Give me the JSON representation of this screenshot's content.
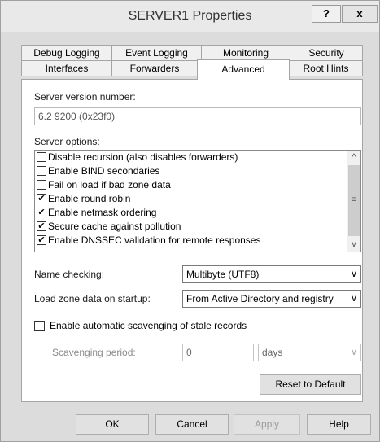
{
  "window": {
    "title": "SERVER1 Properties",
    "help_label": "?",
    "close_label": "x"
  },
  "tabs": {
    "row_top": [
      "Debug Logging",
      "Event Logging",
      "Monitoring",
      "Security"
    ],
    "row_bottom": [
      "Interfaces",
      "Forwarders",
      "Advanced",
      "Root Hints"
    ],
    "active": "Advanced"
  },
  "advanced": {
    "version_label": "Server version number:",
    "version_value": "6.2 9200 (0x23f0)",
    "options_label": "Server options:",
    "options": [
      {
        "label": "Disable recursion (also disables forwarders)",
        "checked": false,
        "mark": ""
      },
      {
        "label": "Enable BIND secondaries",
        "checked": false,
        "mark": ""
      },
      {
        "label": "Fail on load if bad zone data",
        "checked": false,
        "mark": ""
      },
      {
        "label": "Enable round robin",
        "checked": true,
        "mark": "✔"
      },
      {
        "label": "Enable netmask ordering",
        "checked": true,
        "mark": "✔"
      },
      {
        "label": "Secure cache against pollution",
        "checked": true,
        "mark": "✔"
      },
      {
        "label": "Enable DNSSEC validation for remote responses",
        "checked": true,
        "mark": "✔"
      }
    ],
    "name_checking_label": "Name checking:",
    "name_checking_value": "Multibyte (UTF8)",
    "load_zone_label": "Load zone data on startup:",
    "load_zone_value": "From Active Directory and registry",
    "scavenging_label": "Enable automatic scavenging of stale records",
    "scavenging_checked": false,
    "scavenging_period_label": "Scavenging period:",
    "scavenging_period_value": "0",
    "scavenging_unit": "days",
    "reset_label": "Reset to Default"
  },
  "buttons": {
    "ok": "OK",
    "cancel": "Cancel",
    "apply": "Apply",
    "help": "Help"
  }
}
